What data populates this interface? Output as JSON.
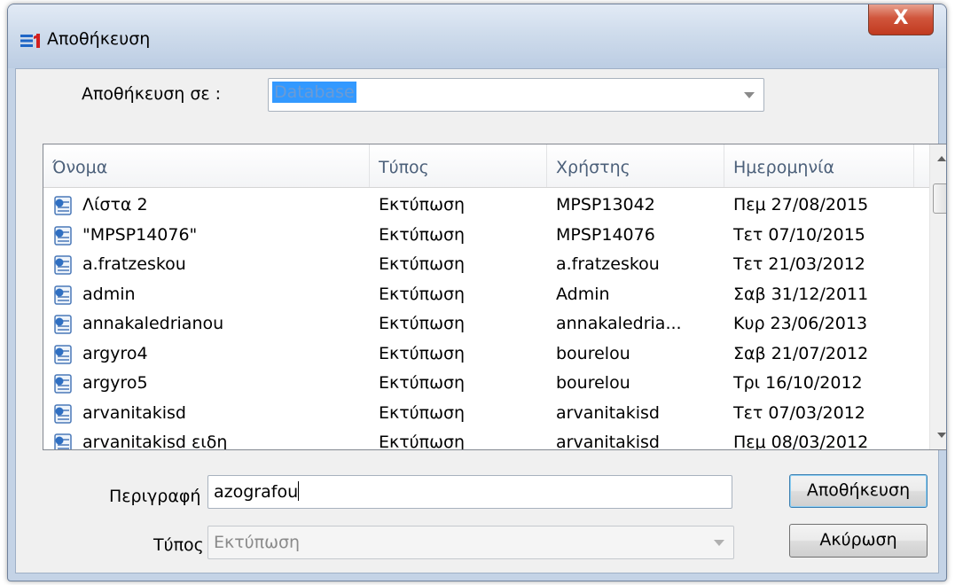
{
  "window": {
    "title": "Αποθήκευση",
    "close_label": "X"
  },
  "save_in": {
    "label": "Αποθήκευση σε :",
    "value": "Database"
  },
  "file_list": {
    "columns": [
      "Όνομα",
      "Τύπος",
      "Χρήστης",
      "Ημερομηνία"
    ],
    "rows": [
      [
        "Λίστα 2",
        "Εκτύπωση",
        "MPSP13042",
        "Πεμ 27/08/2015"
      ],
      [
        "\"MPSP14076\"",
        "Εκτύπωση",
        "MPSP14076",
        "Τετ 07/10/2015"
      ],
      [
        "a.fratzeskou",
        "Εκτύπωση",
        "a.fratzeskou",
        "Τετ 21/03/2012"
      ],
      [
        "admin",
        "Εκτύπωση",
        "Admin",
        "Σαβ 31/12/2011"
      ],
      [
        "annakaledrianou",
        "Εκτύπωση",
        "annakaledria...",
        "Κυρ 23/06/2013"
      ],
      [
        "argyro4",
        "Εκτύπωση",
        "bourelou",
        "Σαβ 21/07/2012"
      ],
      [
        "argyro5",
        "Εκτύπωση",
        "bourelou",
        "Τρι 16/10/2012"
      ],
      [
        "arvanitakisd",
        "Εκτύπωση",
        "arvanitakisd",
        "Τετ 07/03/2012"
      ],
      [
        "arvanitakisd ειδη",
        "Εκτύπωση",
        "arvanitakisd",
        "Πεμ 08/03/2012"
      ]
    ]
  },
  "description": {
    "label": "Περιγραφή",
    "value": "azografou"
  },
  "type": {
    "label": "Τύπος",
    "value": "Εκτύπωση"
  },
  "buttons": {
    "save": "Αποθήκευση",
    "cancel": "Ακύρωση"
  },
  "colors": {
    "selection": "#3399ff",
    "title_bar": "#cfdcec",
    "close_button": "#c94a30"
  },
  "icons": {
    "app_logo": "s1-logo-icon",
    "row_icon": "report-file-icon"
  }
}
